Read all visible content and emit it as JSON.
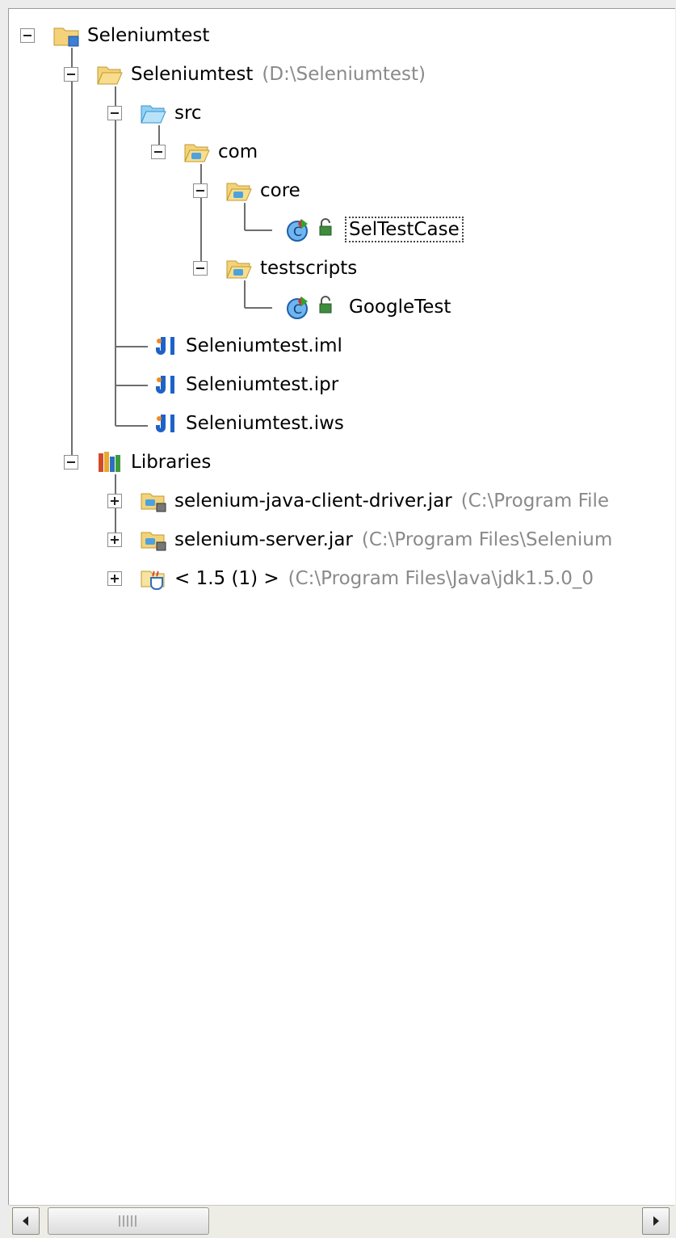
{
  "tree": {
    "root": {
      "label": "Seleniumtest",
      "icon": "project-folder-icon"
    },
    "module": {
      "label": "Seleniumtest",
      "path": "(D:\\Seleniumtest)"
    },
    "src": {
      "label": "src"
    },
    "com": {
      "label": "com"
    },
    "core": {
      "label": "core"
    },
    "seltestcase": {
      "label": "SelTestCase",
      "selected": true
    },
    "testscripts": {
      "label": "testscripts"
    },
    "googletest": {
      "label": "GoogleTest"
    },
    "files": [
      {
        "label": "Seleniumtest.iml"
      },
      {
        "label": "Seleniumtest.ipr"
      },
      {
        "label": "Seleniumtest.iws"
      }
    ],
    "libraries": {
      "label": "Libraries"
    },
    "libs": [
      {
        "label": "selenium-java-client-driver.jar",
        "path": "(C:\\Program File"
      },
      {
        "label": "selenium-server.jar",
        "path": "(C:\\Program Files\\Selenium"
      },
      {
        "label": "< 1.5 (1) >",
        "path": "(C:\\Program Files\\Java\\jdk1.5.0_0"
      }
    ]
  },
  "colors": {
    "path_text": "#8a8a8a",
    "folder": "#f5c84a",
    "source_folder": "#6ec3f2",
    "class_icon": "#3a8ee6"
  }
}
